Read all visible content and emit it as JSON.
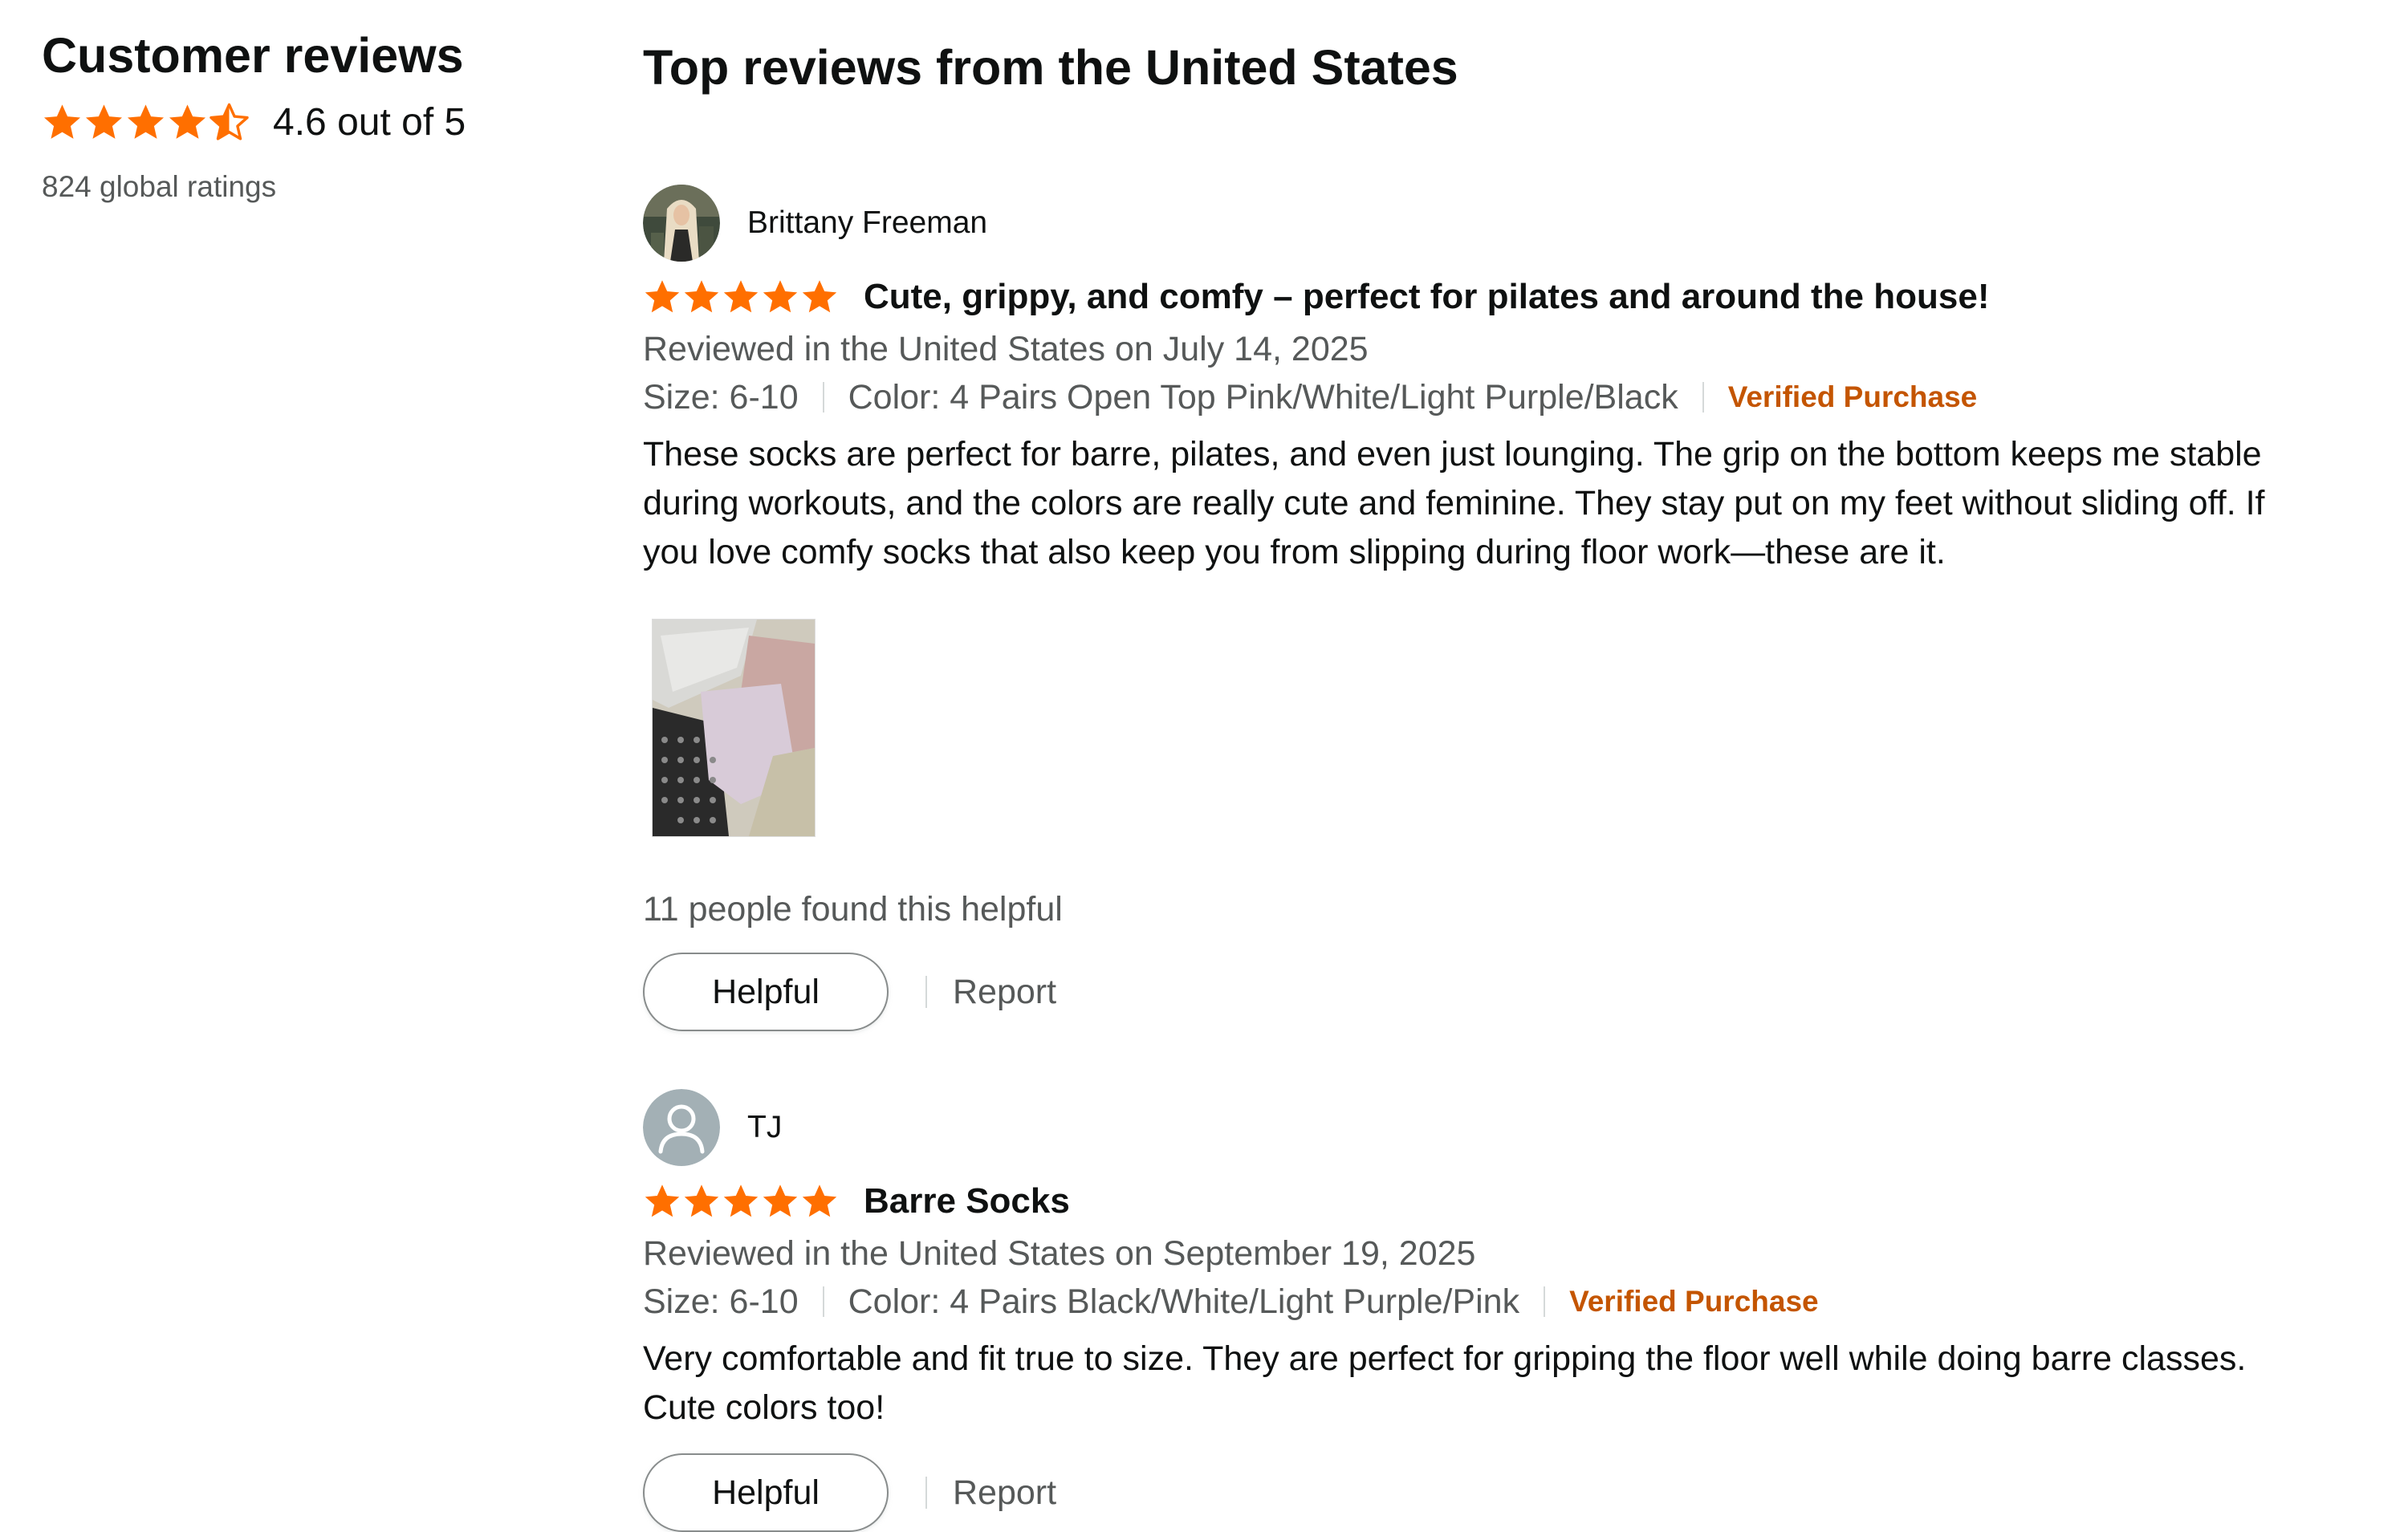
{
  "summary": {
    "title": "Customer reviews",
    "rating_text": "4.6 out of 5",
    "rating_value": 4.6,
    "ratings_count": "824 global ratings"
  },
  "reviews_section": {
    "title": "Top reviews from the United States"
  },
  "reviews": [
    {
      "reviewer": "Brittany Freeman",
      "rating": 5,
      "title": "Cute, grippy, and comfy – perfect for pilates and around the house!",
      "date": "Reviewed in the United States on July 14, 2025",
      "size": "Size: 6-10",
      "color": "Color: 4 Pairs Open Top Pink/White/Light Purple/Black",
      "verified": "Verified Purchase",
      "body": "These socks are perfect for barre, pilates, and even just lounging. The grip on the bottom keeps me stable during workouts, and the colors are really cute and feminine. They stay put on my feet without sliding off. If you love comfy socks that also keep you from slipping during floor work—these are it.",
      "helpful_count": "11 people found this helpful",
      "helpful_label": "Helpful",
      "report_label": "Report"
    },
    {
      "reviewer": "TJ",
      "rating": 5,
      "title": "Barre Socks",
      "date": "Reviewed in the United States on September 19, 2025",
      "size": "Size: 6-10",
      "color": "Color: 4 Pairs Black/White/Light Purple/Pink",
      "verified": "Verified Purchase",
      "body": "Very comfortable and fit true to size. They are perfect for gripping the floor well while doing barre classes. Cute colors too!",
      "helpful_label": "Helpful",
      "report_label": "Report"
    }
  ],
  "colors": {
    "star": "#ff6f00",
    "verified": "#c45500",
    "muted_text": "#565959",
    "text": "#0f1111"
  },
  "icons": {
    "star": "star-icon",
    "half_star": "star-half-icon",
    "default_avatar": "person-icon"
  }
}
